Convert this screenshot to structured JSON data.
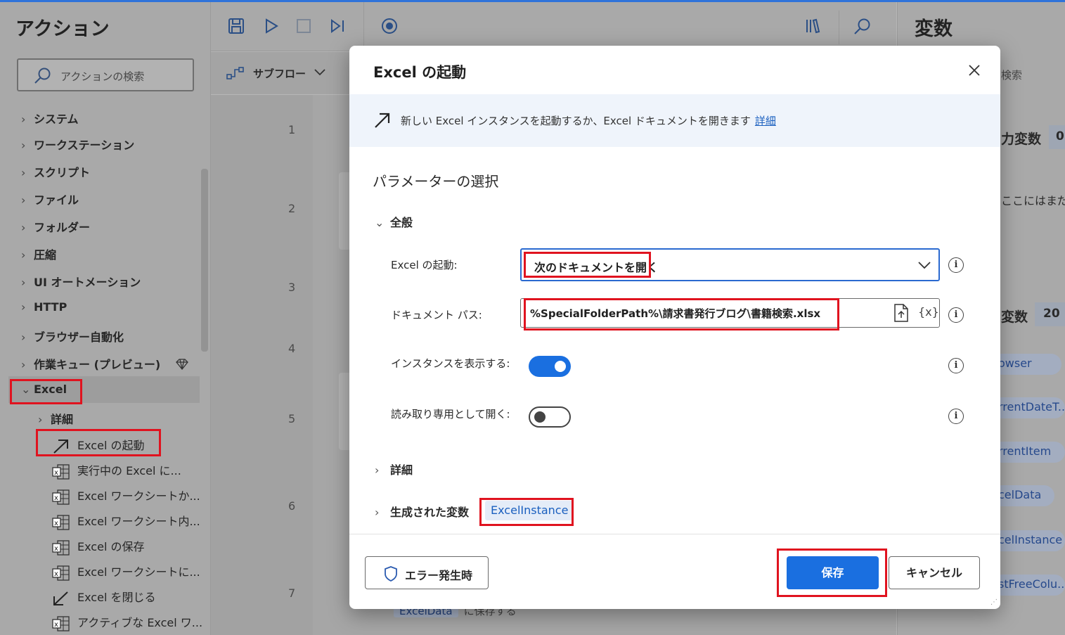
{
  "actions_panel": {
    "title": "アクション",
    "search_placeholder": "アクションの検索",
    "categories": [
      {
        "label": "システム",
        "partial": true
      },
      {
        "label": "ワークステーション"
      },
      {
        "label": "スクリプト"
      },
      {
        "label": "ファイル"
      },
      {
        "label": "フォルダー"
      },
      {
        "label": "圧縮"
      },
      {
        "label": "UI オートメーション"
      },
      {
        "label": "HTTP"
      },
      {
        "label": "ブラウザー自動化"
      },
      {
        "label": "作業キュー (プレビュー)"
      },
      {
        "label": "Excel",
        "expanded": true
      }
    ],
    "excel_children": [
      {
        "label": "詳細",
        "type": "group"
      },
      {
        "label": "Excel の起動",
        "icon": "launch-arrow-icon",
        "selected": true
      },
      {
        "label": "実行中の Excel に...",
        "icon": "excel-icon"
      },
      {
        "label": "Excel ワークシートか...",
        "icon": "excel-icon"
      },
      {
        "label": "Excel ワークシート内...",
        "icon": "excel-icon"
      },
      {
        "label": "Excel の保存",
        "icon": "excel-icon"
      },
      {
        "label": "Excel ワークシートに...",
        "icon": "excel-icon"
      },
      {
        "label": "Excel を閉じる",
        "icon": "close-arrow-icon"
      },
      {
        "label": "アクティブな Excel ワ...",
        "icon": "excel-icon"
      }
    ]
  },
  "editor": {
    "subflow_tab": "サブフロー",
    "line_numbers": [
      "1",
      "2",
      "3",
      "4",
      "5",
      "6",
      "7"
    ],
    "bottom_step_var": "ExcelData",
    "bottom_step_text": "に保存する"
  },
  "variables_panel": {
    "title": "変数",
    "search_partial": "検索",
    "input_vars_label": "力変数",
    "input_vars_count": "0",
    "empty_text": "ここにはまだ入",
    "flow_vars_label": "変数",
    "flow_vars_count": "20",
    "var_pills": [
      "owser",
      "rrentDateT...",
      "rrentItem",
      "celData",
      "celInstance",
      "stFreeColu..."
    ]
  },
  "dialog": {
    "title": "Excel の起動",
    "description": "新しい Excel インスタンスを起動するか、Excel ドキュメントを開きます",
    "details_link": "詳細",
    "param_title": "パラメーターの選択",
    "general_section": "全般",
    "launch_label": "Excel の起動:",
    "launch_value": "次のドキュメントを開く",
    "doc_path_label": "ドキュメント パス:",
    "doc_path_value": "%SpecialFolderPath%\\請求書発行ブログ\\書籍検索.xlsx",
    "var_button": "{x}",
    "show_instance_label": "インスタンスを表示する:",
    "show_instance_on": true,
    "readonly_label": "読み取り専用として開く:",
    "readonly_on": false,
    "details_section": "詳細",
    "generated_vars_label": "生成された変数",
    "generated_var": "ExcelInstance",
    "on_error_button": "エラー発生時",
    "save_button": "保存",
    "cancel_button": "キャンセル"
  },
  "colors": {
    "accent": "#1a6fe0",
    "highlight": "#e0131f",
    "link": "#1a5fbf"
  }
}
